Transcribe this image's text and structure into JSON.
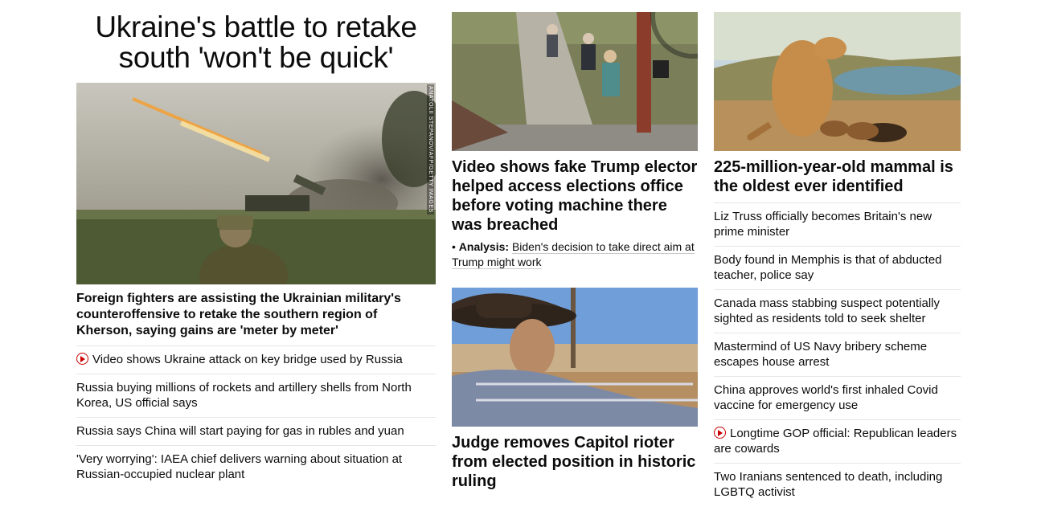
{
  "left": {
    "headline": "Ukraine's battle to retake south 'won't be quick'",
    "photo_credit": "ANATOLII STEPANOV/AFP/GETTY IMAGES",
    "description": "Foreign fighters are assisting the Ukrainian military's counteroffensive to retake the southern region of Kherson, saying gains are 'meter by meter'",
    "links": [
      {
        "text": "Video shows Ukraine attack on key bridge used by Russia",
        "video": true
      },
      {
        "text": "Russia buying millions of rockets and artillery shells from North Korea, US official says",
        "video": false
      },
      {
        "text": "Russia says China will start paying for gas in rubles and yuan",
        "video": false
      },
      {
        "text": "'Very worrying': IAEA chief delivers warning about situation at Russian-occupied nuclear plant",
        "video": false
      }
    ]
  },
  "middle": {
    "story1": {
      "headline": "Video shows fake Trump elector helped access elections office before voting machine there was breached",
      "analysis_label": "Analysis:",
      "analysis_text": "Biden's decision to take direct aim at Trump might work"
    },
    "story2": {
      "headline": "Judge removes Capitol rioter from elected position in historic ruling"
    }
  },
  "right": {
    "headline": "225-million-year-old mammal is the oldest ever identified",
    "links": [
      {
        "text": "Liz Truss officially becomes Britain's new prime minister",
        "video": false
      },
      {
        "text": "Body found in Memphis is that of abducted teacher, police say",
        "video": false
      },
      {
        "text": "Canada mass stabbing suspect potentially sighted as residents told to seek shelter",
        "video": false
      },
      {
        "text": "Mastermind of US Navy bribery scheme escapes house arrest",
        "video": false
      },
      {
        "text": "China approves world's first inhaled Covid vaccine for emergency use",
        "video": false
      },
      {
        "text": "Longtime GOP official: Republican leaders are cowards",
        "video": true
      },
      {
        "text": "Two Iranians sentenced to death, including LGBTQ activist",
        "video": false
      }
    ]
  },
  "colors": {
    "video_icon": "#cc0000",
    "text": "#0c0c0c",
    "divider": "#e6e6e6"
  }
}
